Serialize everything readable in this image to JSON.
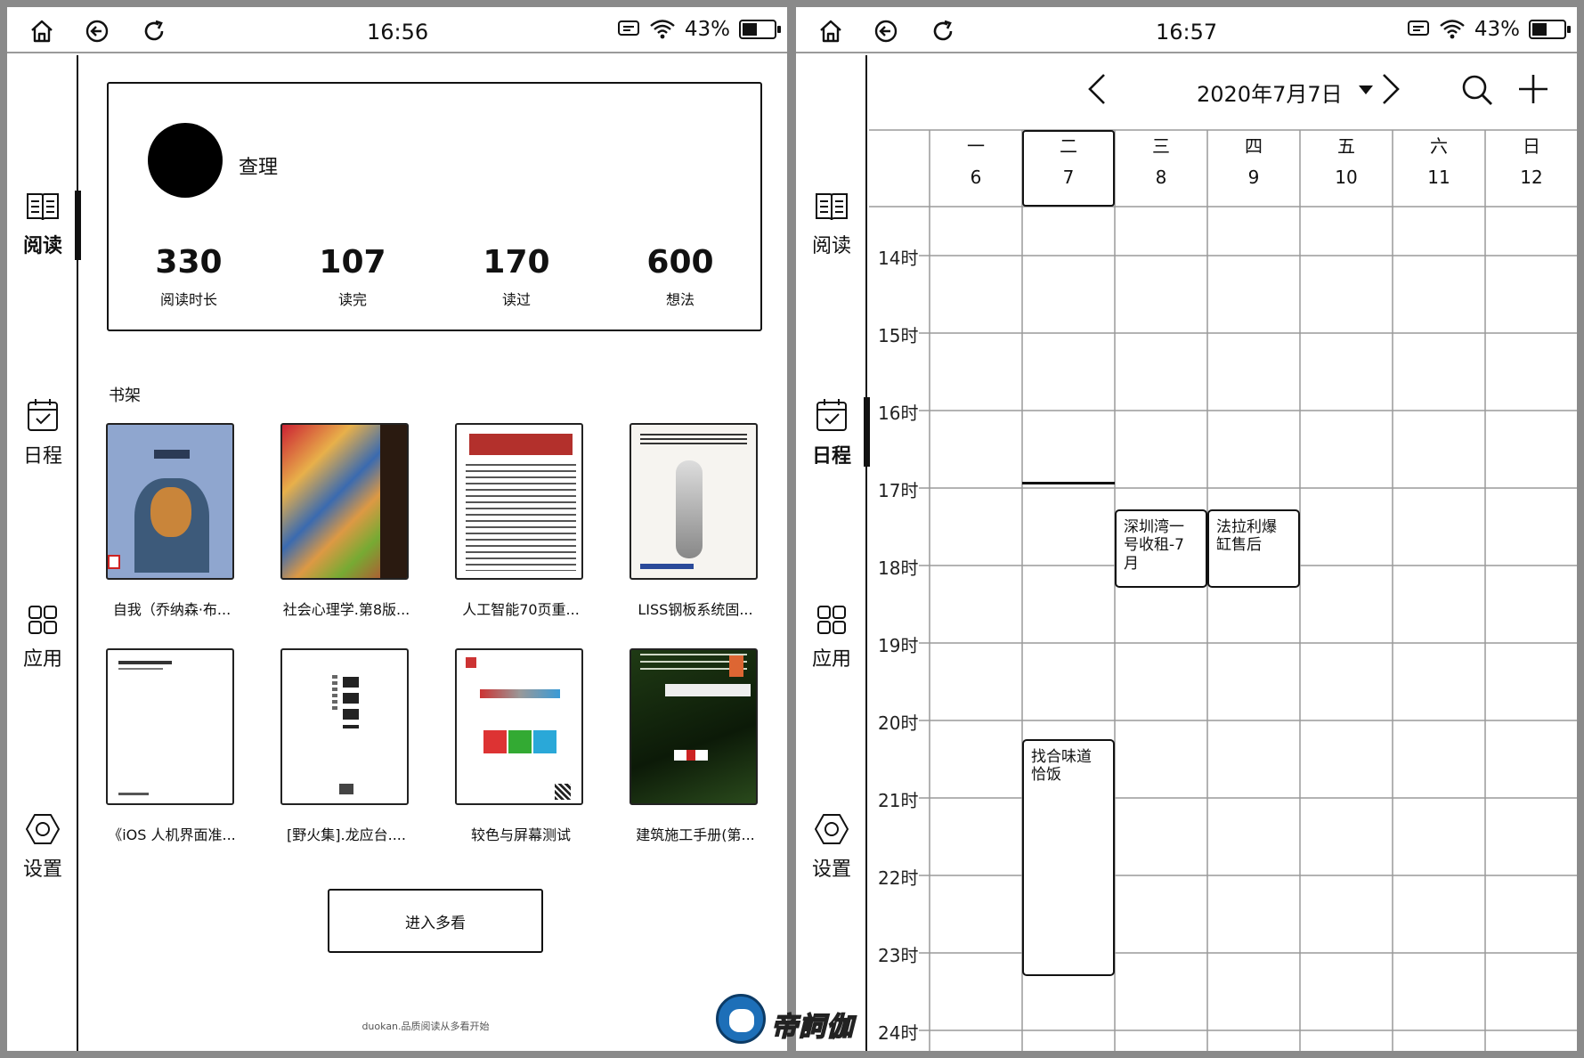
{
  "left": {
    "status": {
      "time": "16:56",
      "battery": "43%",
      "battery_level": 0.43
    },
    "nav": [
      {
        "label": "阅读",
        "icon": "book-icon",
        "active": true
      },
      {
        "label": "日程",
        "icon": "calendar-icon",
        "active": false
      },
      {
        "label": "应用",
        "icon": "apps-icon",
        "active": false
      },
      {
        "label": "设置",
        "icon": "settings-icon",
        "active": false
      }
    ],
    "profile": {
      "name": "查理",
      "stats": [
        {
          "value": "330",
          "label": "阅读时长"
        },
        {
          "value": "107",
          "label": "读完"
        },
        {
          "value": "170",
          "label": "读过"
        },
        {
          "value": "600",
          "label": "想法"
        }
      ]
    },
    "shelf": {
      "title": "书架",
      "books": [
        {
          "title": "自我（乔纳森·布..."
        },
        {
          "title": "社会心理学.第8版..."
        },
        {
          "title": "人工智能70页重..."
        },
        {
          "title": "LISS钢板系统固..."
        },
        {
          "title": "《iOS 人机界面准..."
        },
        {
          "title": "[野火集].龙应台...."
        },
        {
          "title": "较色与屏幕测试"
        },
        {
          "title": "建筑施工手册(第..."
        }
      ],
      "more_button": "进入多看"
    },
    "footer": "duokan.品质阅读从多看开始",
    "watermark": "帝詞伽"
  },
  "right": {
    "status": {
      "time": "16:57",
      "battery": "43%",
      "battery_level": 0.43
    },
    "calendar": {
      "current_date": "2020年7月7日",
      "days": [
        {
          "weekday": "一",
          "date": "6"
        },
        {
          "weekday": "二",
          "date": "7",
          "selected": true
        },
        {
          "weekday": "三",
          "date": "8"
        },
        {
          "weekday": "四",
          "date": "9"
        },
        {
          "weekday": "五",
          "date": "10"
        },
        {
          "weekday": "六",
          "date": "11"
        },
        {
          "weekday": "日",
          "date": "12"
        }
      ],
      "hours": [
        "14时",
        "15时",
        "16时",
        "17时",
        "18时",
        "19时",
        "20时",
        "21时",
        "22时",
        "23时",
        "24时"
      ],
      "events": [
        {
          "title": "深圳湾一号收租-7月",
          "day": "三"
        },
        {
          "title": "法拉利爆缸售后",
          "day": "四"
        },
        {
          "title": "找合味道恰饭",
          "day": "二"
        }
      ]
    }
  }
}
